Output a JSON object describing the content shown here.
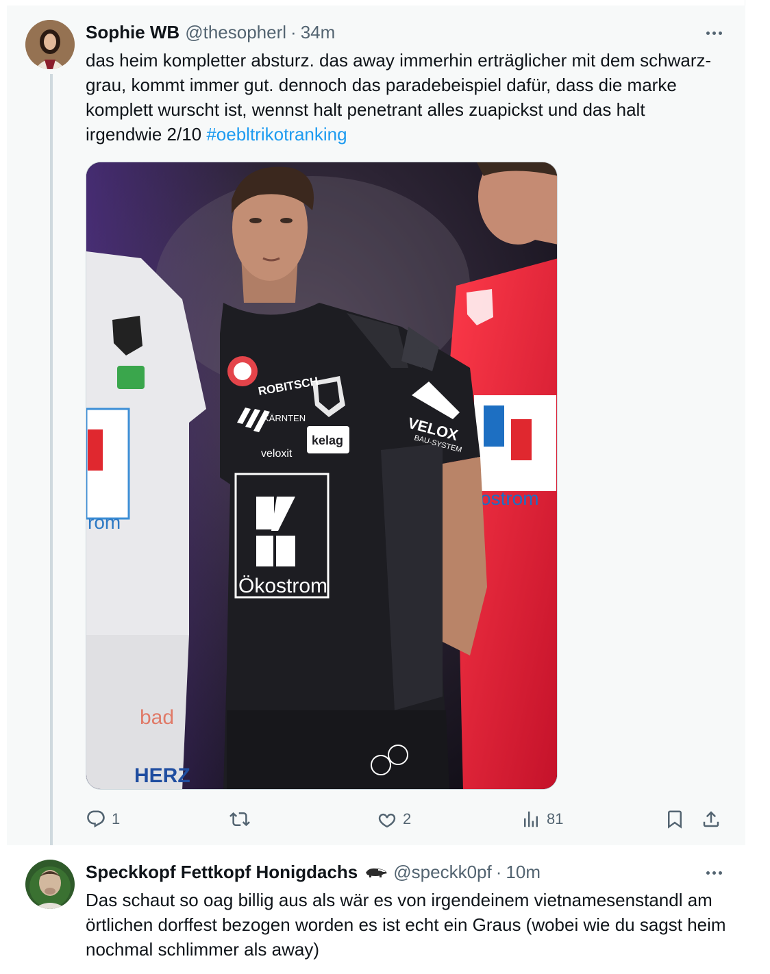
{
  "tweets": [
    {
      "author": "Sophie WB",
      "handle": "@thesopherl",
      "separator": "·",
      "time": "34m",
      "text": "das heim kompletter absturz. das away immerhin erträglicher mit dem schwarz-grau, kommt immer gut. dennoch das paradebeispiel dafür, dass die marke komplett wurscht ist, wennst halt penetrant alles zuapickst und das halt irgendwie 2/10 ",
      "hashtag": "#oebltrikotranking",
      "media": {
        "texts": {
          "robitsch": "ROBITSCH",
          "karnten": "KÄRNTEN",
          "kelag": "kelag",
          "velox": "veloxit",
          "sponsor_box": "Ökostrom",
          "velox_logo": "VELOX",
          "velox_sub": "BAU-SYSTEM",
          "left_strom": "rom",
          "left_bad": "bad",
          "left_herz": "HERZ",
          "right_strom": "ostrom"
        }
      },
      "stats": {
        "replies": "1",
        "retweets": "",
        "likes": "2",
        "views": "81"
      }
    },
    {
      "author": "Speckkopf Fettkopf Honigdachs",
      "handle": "@speckk0pf",
      "separator": "·",
      "time": "10m",
      "badge_icon": "badger-icon",
      "text": "Das schaut so oag billig aus als wär es von irgendeinem vietnamesenstandl am örtlichen dorffest bezogen worden es ist echt ein Graus (wobei wie du sagst heim nochmal schlimmer als away)"
    }
  ],
  "icons": {
    "reply": "reply-icon",
    "retweet": "retweet-icon",
    "like": "heart-icon",
    "views": "views-icon",
    "bookmark": "bookmark-icon",
    "share": "share-icon",
    "more": "more-icon"
  },
  "colors": {
    "link": "#1d9bf0",
    "text": "#0f1419",
    "secondary": "#536471",
    "highlight_bg": "#f7f9f9"
  }
}
